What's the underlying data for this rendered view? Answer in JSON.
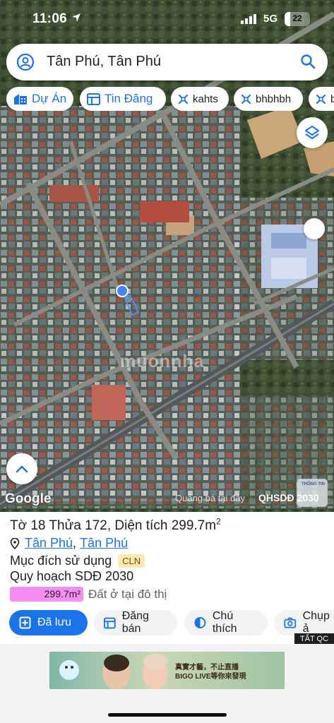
{
  "status": {
    "time": "11:06",
    "network": "5G",
    "battery": "22",
    "battery_level": 0.22
  },
  "search": {
    "query": "Tân Phú, Tân Phú"
  },
  "chips": [
    {
      "label": "Dự Án",
      "icon": "building-icon"
    },
    {
      "label": "Tin Đăng",
      "icon": "list-icon"
    },
    {
      "label": "kahts",
      "icon": "tag-icon"
    },
    {
      "label": "bhbhbh",
      "icon": "tag-icon"
    },
    {
      "label": "b",
      "icon": "tag-icon"
    }
  ],
  "map": {
    "google_logo": "Google",
    "ad_caption": "Quảng bá tại đây",
    "layer_label": "QHSDĐ 2030",
    "thumb_text": "THÔNG TIN",
    "watermark": "muonnha"
  },
  "parcel": {
    "to_label": "Tờ 18",
    "thua_label": "Thửa 172,",
    "dien_tich_label": "Diện tích",
    "area_value": "299.7m",
    "area_unit_sup": "2",
    "location_ward": "Tân Phú",
    "location_district": "Tân Phú",
    "purpose_label": "Mục đích sử dụng",
    "purpose_code": "CLN",
    "planning_label": "Quy hoạch SDĐ 2030",
    "planning_area": "299.7m²",
    "planning_desc": "Đất ở tại đô thị",
    "planning_color": "#f58df2"
  },
  "actions": [
    {
      "label": "Đã lưu",
      "icon": "bookmark-plus-icon"
    },
    {
      "label": "Đăng bán",
      "icon": "listing-icon"
    },
    {
      "label": "Chú thích",
      "icon": "contrast-icon"
    },
    {
      "label": "Chụp ả",
      "icon": "camera-icon"
    }
  ],
  "ad": {
    "close_label": "TẮT QC",
    "banner_line1": "真實才藝，不止直播",
    "banner_line2": "BIGO LIVE等你來發現",
    "brand": "BIGO LIVE"
  },
  "colors": {
    "accent": "#1a73e8",
    "badge_bg": "#fce8b2"
  }
}
